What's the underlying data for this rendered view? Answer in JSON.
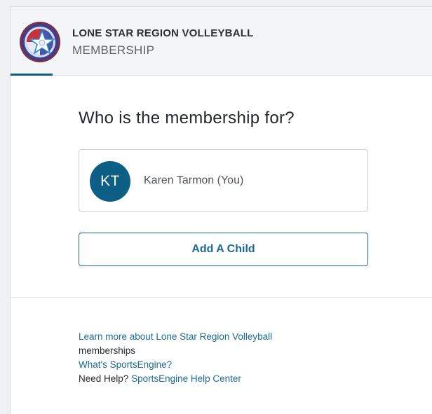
{
  "header": {
    "org_name": "LONE STAR REGION VOLLEYBALL",
    "subtitle": "MEMBERSHIP",
    "logo_icon": "region-logo-star-icon"
  },
  "main": {
    "question": "Who is the membership for?",
    "member": {
      "initials": "KT",
      "name": "Karen Tarmon (You)"
    },
    "add_child_label": "Add A Child"
  },
  "footer": {
    "learn_more_link": "Learn more about Lone Star Region Volleyball",
    "learn_more_rest": "memberships",
    "whats_link": "What's SportsEngine?",
    "help_prefix": "Need Help?",
    "help_link": "SportsEngine Help Center"
  },
  "colors": {
    "accent": "#0b5e84",
    "avatar_bg": "#0e5f86",
    "link": "#1b6b93"
  }
}
